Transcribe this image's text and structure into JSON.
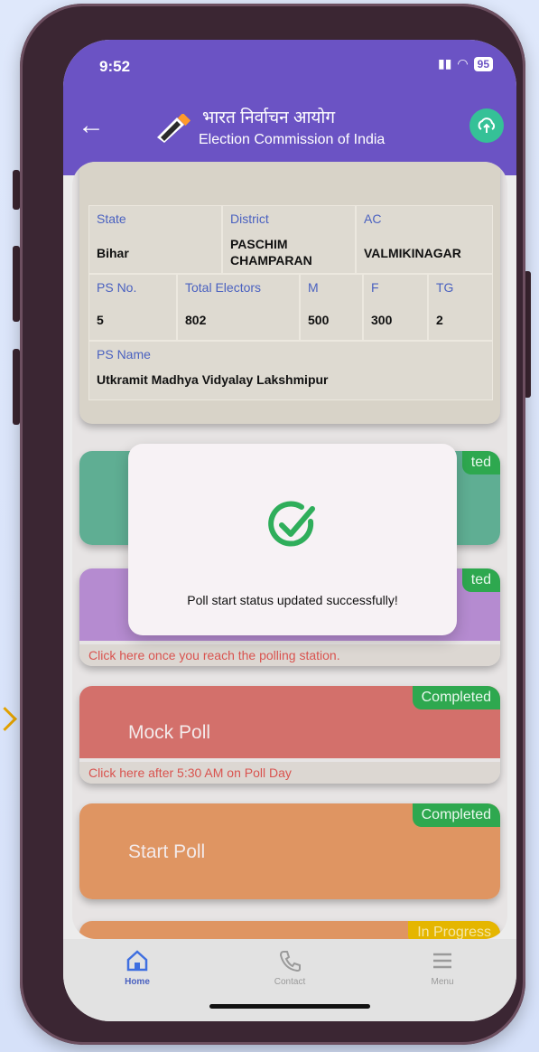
{
  "status_bar": {
    "time": "9:52",
    "battery": "95"
  },
  "header": {
    "title_hindi": "भारत निर्वाचन आयोग",
    "title_english": "Election Commission of India"
  },
  "polling_info": {
    "state_label": "State",
    "state_value": "Bihar",
    "district_label": "District",
    "district_value_line1": "PASCHIM",
    "district_value_line2": "CHAMPARAN",
    "ac_label": "AC",
    "ac_value": "VALMIKINAGAR",
    "ps_no_label": "PS No.",
    "ps_no_value": "5",
    "total_electors_label": "Total Electors",
    "total_electors_value": "802",
    "m_label": "M",
    "m_value": "500",
    "f_label": "F",
    "f_value": "300",
    "tg_label": "TG",
    "tg_value": "2",
    "ps_name_label": "PS Name",
    "ps_name_value": "Utkramit Madhya Vidyalay Lakshmipur"
  },
  "tiles": [
    {
      "badge": "ted",
      "color": "#5fae93"
    },
    {
      "badge": "ted",
      "hint": "Click here once you reach the polling station.",
      "color": "#b58bd0"
    },
    {
      "title": "Mock Poll",
      "badge": "Completed",
      "hint": "Click here after 5:30 AM on Poll Day",
      "color": "#d3706b"
    },
    {
      "title": "Start Poll",
      "badge": "Completed",
      "color": "#df9562"
    },
    {
      "badge": "In Progress",
      "color": "#df9562"
    }
  ],
  "modal": {
    "message": "Poll start status updated successfully!"
  },
  "bottom_nav": [
    {
      "label": "Home",
      "active": true
    },
    {
      "label": "Contact"
    },
    {
      "label": "Menu"
    }
  ]
}
